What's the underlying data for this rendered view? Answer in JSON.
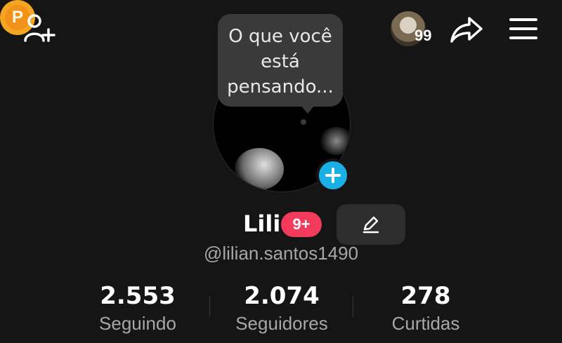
{
  "topbar": {
    "add_friend_icon": "add-person-icon",
    "coin_letter": "P",
    "visitor_count": "99",
    "share_icon": "share-arrow-icon",
    "menu_icon": "hamburger-menu-icon"
  },
  "status_bubble": {
    "text": "O que você está pensando..."
  },
  "profile": {
    "name": "Lili",
    "notification_badge": "9+",
    "username": "@lilian.santos1490"
  },
  "stats": [
    {
      "value": "2.553",
      "label": "Seguindo"
    },
    {
      "value": "2.074",
      "label": "Seguidores"
    },
    {
      "value": "278",
      "label": "Curtidas"
    }
  ],
  "colors": {
    "background": "#151515",
    "accent_blue": "#1ab0e6",
    "badge_red": "#f23a5b",
    "coin_gold": "#f4a623"
  }
}
